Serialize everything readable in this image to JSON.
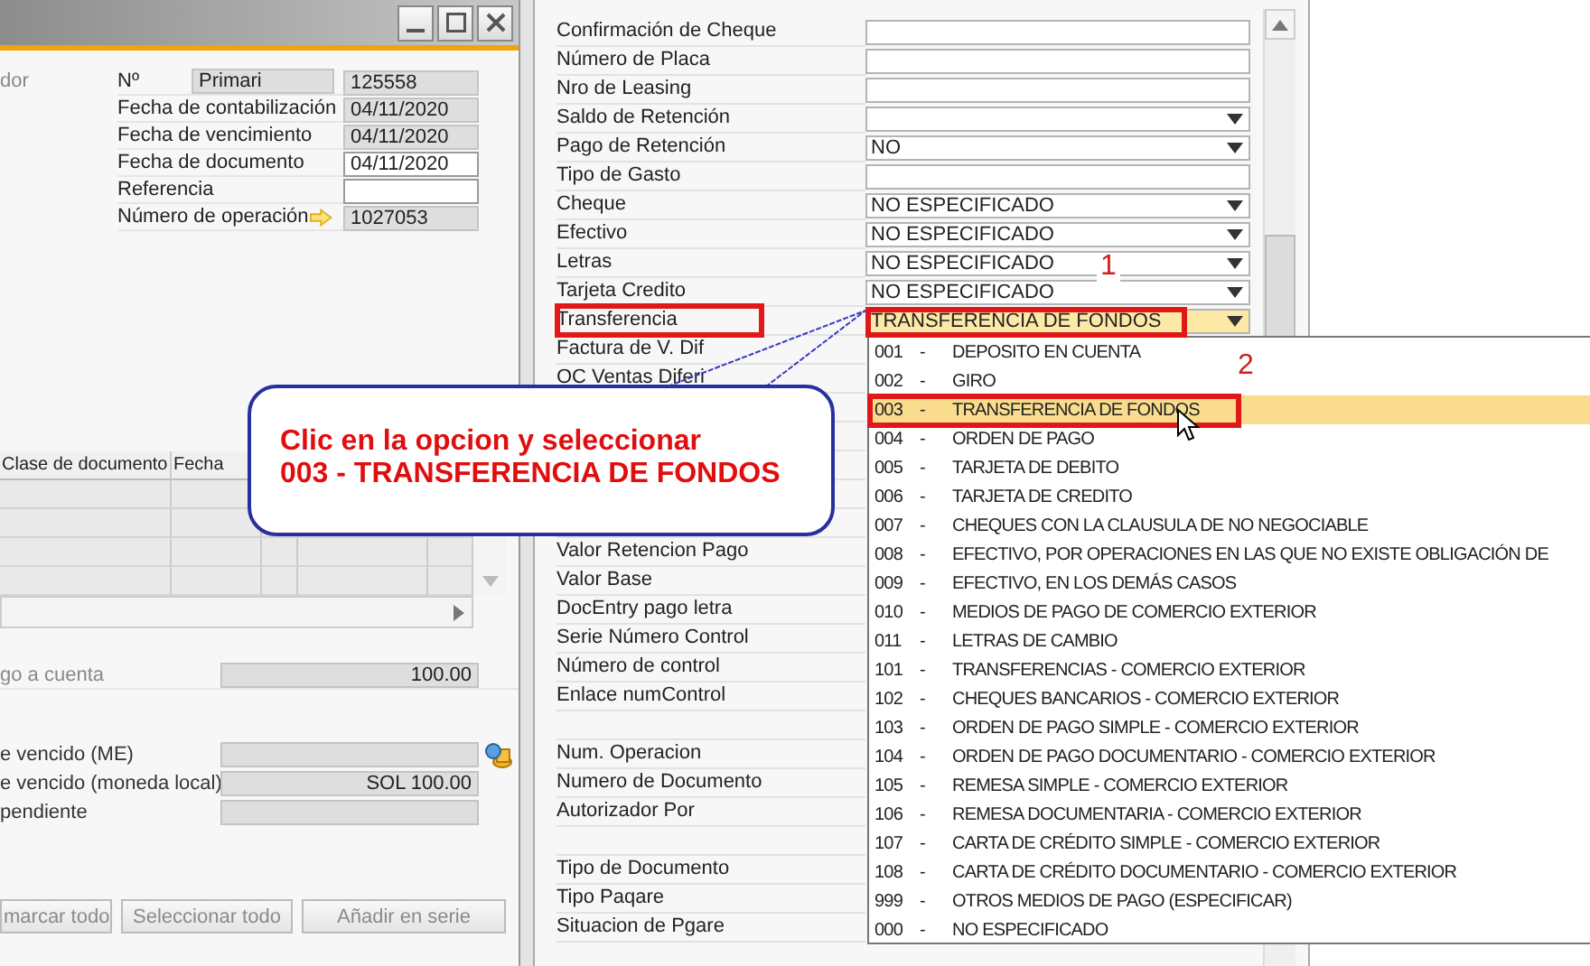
{
  "left_window": {
    "partial_label": "dor",
    "header_fields": [
      {
        "label": "Nº",
        "series": "Primari",
        "value": "125558",
        "editable": false
      },
      {
        "label": "Fecha de contabilización",
        "value": "04/11/2020",
        "editable": false
      },
      {
        "label": "Fecha de vencimiento",
        "value": "04/11/2020",
        "editable": false
      },
      {
        "label": "Fecha de documento",
        "value": "04/11/2020",
        "editable": true
      },
      {
        "label": "Referencia",
        "editable": true
      },
      {
        "label": "Número de operación",
        "value": "1027053",
        "editable": false,
        "link_arrow": true
      }
    ],
    "table": {
      "columns": [
        "Clase de documento",
        "Fecha"
      ]
    },
    "totals": [
      {
        "label": "go a cuenta",
        "value": "100.00",
        "muted": true
      },
      {
        "label": "e vencido (ME)",
        "currency_button": true,
        "muted": false
      },
      {
        "label": "e vencido (moneda local)",
        "value": "SOL 100.00",
        "muted": false
      },
      {
        "label": "pendiente",
        "muted": false
      }
    ],
    "buttons": [
      {
        "label": "marcar todo",
        "disabled": true
      },
      {
        "label": "Seleccionar todo",
        "disabled": true
      },
      {
        "label": "Añadir en serie",
        "disabled": true
      }
    ]
  },
  "right_panel": {
    "fields": [
      {
        "label": "Confirmación de Cheque",
        "kind": "text"
      },
      {
        "label": "Número de Placa",
        "kind": "text"
      },
      {
        "label": "Nro de Leasing",
        "kind": "text"
      },
      {
        "label": "Saldo de Retención",
        "kind": "combo",
        "focused": false
      },
      {
        "label": "Pago de Retención",
        "kind": "combo",
        "value": "NO",
        "focused": false
      },
      {
        "label": "Tipo de Gasto",
        "kind": "text"
      },
      {
        "label": "Cheque",
        "kind": "combo",
        "value": "NO ESPECIFICADO",
        "focused": false
      },
      {
        "label": "Efectivo",
        "kind": "combo",
        "value": "NO ESPECIFICADO",
        "focused": false
      },
      {
        "label": "Letras",
        "kind": "combo",
        "value": "NO ESPECIFICADO",
        "focused": false
      },
      {
        "label": "Tarjeta Credito",
        "kind": "combo",
        "value": "NO ESPECIFICADO",
        "focused": false
      },
      {
        "label": "Transferencia",
        "kind": "combo",
        "value": "TRANSFERENCIA DE FONDOS",
        "focused": true
      },
      {
        "label": "Factura de V. Dif",
        "kind": "label"
      },
      {
        "label": "OC Ventas Diferi",
        "kind": "label"
      },
      {
        "kind": "empty"
      },
      {
        "kind": "empty"
      },
      {
        "kind": "empty"
      },
      {
        "kind": "empty"
      },
      {
        "kind": "empty"
      },
      {
        "label": "Valor Retencion Pago",
        "kind": "label"
      },
      {
        "label": "Valor Base",
        "kind": "label"
      },
      {
        "label": "DocEntry pago letra",
        "kind": "label"
      },
      {
        "label": "Serie Número Control",
        "kind": "label"
      },
      {
        "label": "Número de control",
        "kind": "label"
      },
      {
        "label": "Enlace numControl",
        "kind": "label"
      },
      {
        "kind": "empty"
      },
      {
        "label": "Num. Operacion",
        "kind": "label"
      },
      {
        "label": "Numero de Documento",
        "kind": "label"
      },
      {
        "label": "Autorizador Por",
        "kind": "label"
      },
      {
        "kind": "empty"
      },
      {
        "label": "Tipo de Documento",
        "kind": "label"
      },
      {
        "label": "Tipo Paqare",
        "kind": "label"
      },
      {
        "label": "Situacion de Pgare",
        "kind": "label"
      }
    ]
  },
  "dropdown": {
    "items": [
      {
        "code": "001",
        "dash": "-",
        "text": "DEPOSITO EN CUENTA",
        "selected": false
      },
      {
        "code": "002",
        "dash": "-",
        "text": "GIRO",
        "selected": false
      },
      {
        "code": "003",
        "dash": "-",
        "text": "TRANSFERENCIA DE FONDOS",
        "selected": true
      },
      {
        "code": "004",
        "dash": "-",
        "text": "ORDEN DE PAGO",
        "selected": false
      },
      {
        "code": "005",
        "dash": "-",
        "text": "TARJETA DE DEBITO",
        "selected": false
      },
      {
        "code": "006",
        "dash": "-",
        "text": "TARJETA DE CREDITO",
        "selected": false
      },
      {
        "code": "007",
        "dash": "-",
        "text": "CHEQUES CON LA CLAUSULA DE NO NEGOCIABLE",
        "selected": false
      },
      {
        "code": "008",
        "dash": "-",
        "text": "EFECTIVO, POR OPERACIONES EN LAS QUE NO EXISTE OBLIGACIÓN DE",
        "selected": false
      },
      {
        "code": "009",
        "dash": "-",
        "text": "EFECTIVO, EN LOS DEMÁS CASOS",
        "selected": false
      },
      {
        "code": "010",
        "dash": "-",
        "text": "MEDIOS DE PAGO DE COMERCIO EXTERIOR",
        "selected": false
      },
      {
        "code": "011",
        "dash": "-",
        "text": "LETRAS DE CAMBIO",
        "selected": false
      },
      {
        "code": "101",
        "dash": "-",
        "text": "TRANSFERENCIAS - COMERCIO EXTERIOR",
        "selected": false
      },
      {
        "code": "102",
        "dash": "-",
        "text": "CHEQUES BANCARIOS - COMERCIO EXTERIOR",
        "selected": false
      },
      {
        "code": "103",
        "dash": "-",
        "text": "ORDEN DE PAGO SIMPLE - COMERCIO EXTERIOR",
        "selected": false
      },
      {
        "code": "104",
        "dash": "-",
        "text": "ORDEN DE PAGO DOCUMENTARIO - COMERCIO EXTERIOR",
        "selected": false
      },
      {
        "code": "105",
        "dash": "-",
        "text": "REMESA SIMPLE - COMERCIO EXTERIOR",
        "selected": false
      },
      {
        "code": "106",
        "dash": "-",
        "text": "REMESA DOCUMENTARIA - COMERCIO EXTERIOR",
        "selected": false
      },
      {
        "code": "107",
        "dash": "-",
        "text": "CARTA DE CRÉDITO SIMPLE - COMERCIO EXTERIOR",
        "selected": false
      },
      {
        "code": "108",
        "dash": "-",
        "text": "CARTA DE CRÉDITO DOCUMENTARIO - COMERCIO EXTERIOR",
        "selected": false
      },
      {
        "code": "999",
        "dash": "-",
        "text": "OTROS MEDIOS DE PAGO (ESPECIFICAR)",
        "selected": false
      },
      {
        "code": "000",
        "dash": "-",
        "text": "NO ESPECIFICADO",
        "selected": false
      }
    ]
  },
  "callout": {
    "lines": [
      "Clic en la opcion y seleccionar",
      "003 - TRANSFERENCIA DE FONDOS"
    ]
  },
  "step_markers": [
    "1",
    "2"
  ]
}
